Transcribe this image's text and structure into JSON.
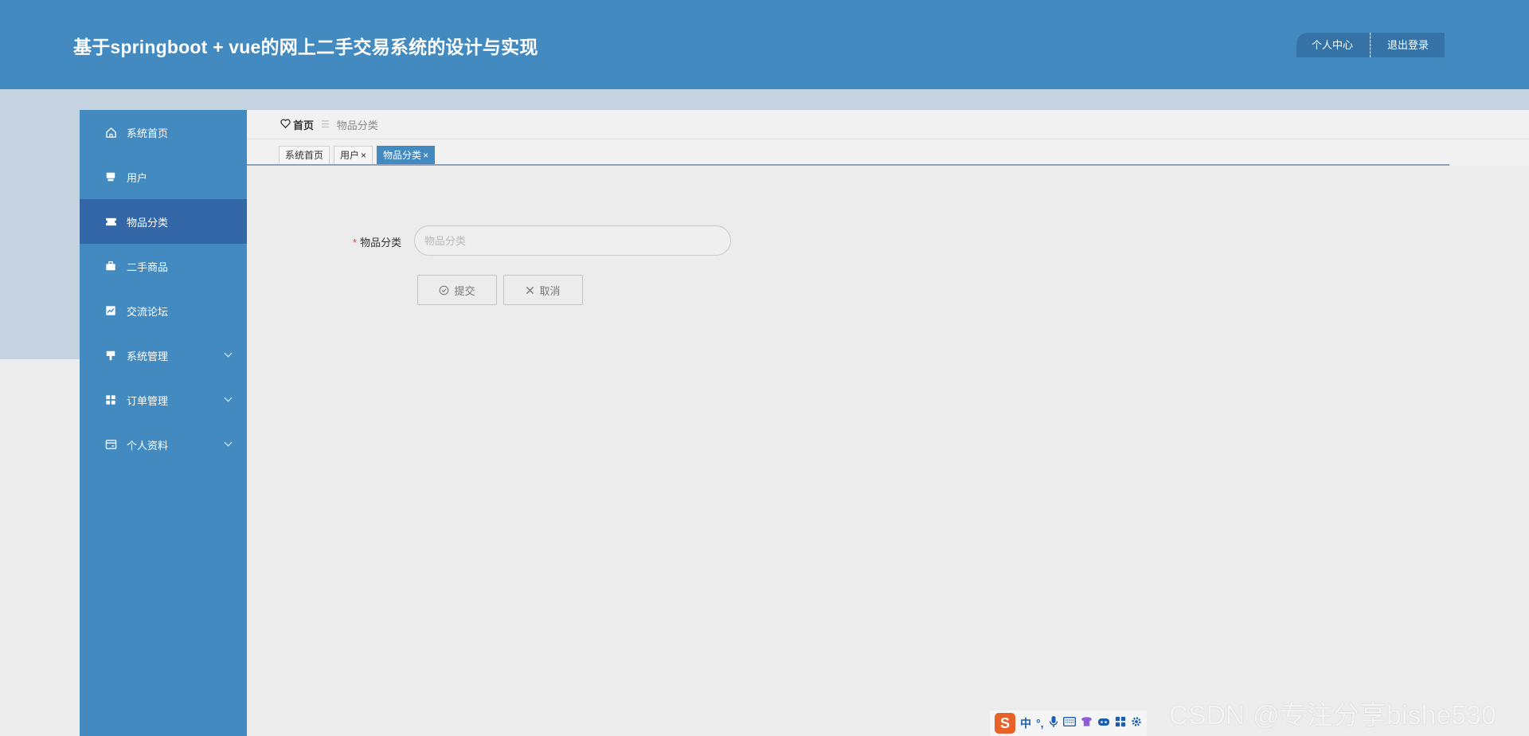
{
  "header": {
    "title": "基于springboot + vue的网上二手交易系统的设计与实现",
    "personal_center": "个人中心",
    "logout": "退出登录"
  },
  "sidebar": {
    "items": [
      {
        "label": "系统首页",
        "icon": "home-icon"
      },
      {
        "label": "用户",
        "icon": "user-icon"
      },
      {
        "label": "物品分类",
        "icon": "category-icon",
        "active": true
      },
      {
        "label": "二手商品",
        "icon": "briefcase-icon"
      },
      {
        "label": "交流论坛",
        "icon": "chart-icon"
      },
      {
        "label": "系统管理",
        "icon": "system-icon",
        "expandable": true
      },
      {
        "label": "订单管理",
        "icon": "grid-icon",
        "expandable": true
      },
      {
        "label": "个人资料",
        "icon": "profile-icon",
        "expandable": true
      }
    ]
  },
  "breadcrumb": {
    "home": "首页",
    "separator": "☰",
    "current": "物品分类"
  },
  "tabs": [
    {
      "label": "系统首页",
      "closable": false
    },
    {
      "label": "用户",
      "closable": true
    },
    {
      "label": "物品分类",
      "closable": true,
      "active": true
    }
  ],
  "tab_close_glyph": "×",
  "form": {
    "category_label": "物品分类",
    "required_mark": "*",
    "category_placeholder": "物品分类",
    "category_value": "",
    "submit_label": "提交",
    "cancel_label": "取消"
  },
  "ime": {
    "logo": "S",
    "mode": "中",
    "punct": "°,"
  },
  "watermark": "CSDN @专注分享bishe530",
  "colors": {
    "header": "#438ac0",
    "sidebar": "#438ac0",
    "active_menu": "#3467a8",
    "band": "#c4d3df",
    "required": "#e64242"
  }
}
